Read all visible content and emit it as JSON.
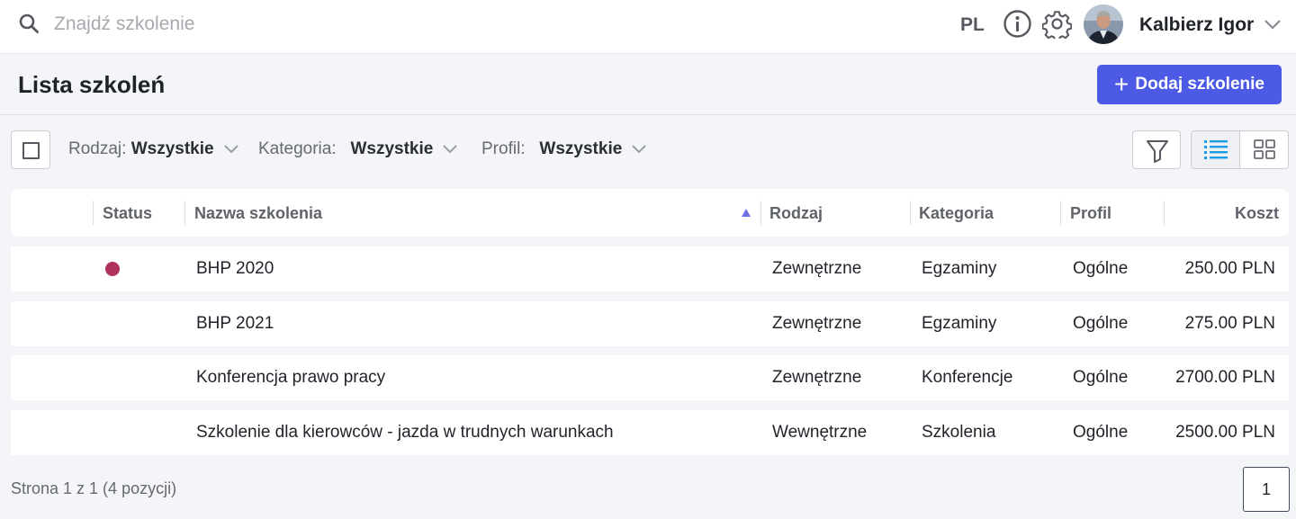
{
  "search": {
    "placeholder": "Znajdź szkolenie",
    "value": ""
  },
  "topbar": {
    "language": "PL",
    "user_name": "Kalbierz Igor"
  },
  "page": {
    "title": "Lista szkoleń",
    "add_button_label": "Dodaj szkolenie"
  },
  "filters": [
    {
      "label": "Rodzaj:",
      "value": "Wszystkie"
    },
    {
      "label": "Kategoria:",
      "value": "Wszystkie"
    },
    {
      "label": "Profil:",
      "value": "Wszystkie"
    }
  ],
  "table": {
    "columns": [
      "Status",
      "Nazwa szkolenia",
      "Rodzaj",
      "Kategoria",
      "Profil",
      "Koszt"
    ],
    "sorted_column": "Nazwa szkolenia",
    "sort_direction": "ascending",
    "rows": [
      {
        "status_color": "#b0335e",
        "name": "BHP 2020",
        "rodzaj": "Zewnętrzne",
        "kategoria": "Egzaminy",
        "profil": "Ogólne",
        "koszt": "250.00 PLN"
      },
      {
        "status_color": "",
        "name": "BHP 2021",
        "rodzaj": "Zewnętrzne",
        "kategoria": "Egzaminy",
        "profil": "Ogólne",
        "koszt": "275.00 PLN"
      },
      {
        "status_color": "",
        "name": "Konferencja prawo pracy",
        "rodzaj": "Zewnętrzne",
        "kategoria": "Konferencje",
        "profil": "Ogólne",
        "koszt": "2700.00 PLN"
      },
      {
        "status_color": "",
        "name": "Szkolenie dla kierowców - jazda w trudnych warunkach",
        "rodzaj": "Wewnętrzne",
        "kategoria": "Szkolenia",
        "profil": "Ogólne",
        "koszt": "2500.00 PLN"
      }
    ]
  },
  "pagination": {
    "info": "Strona 1 z 1 (4 pozycji)",
    "current_page": "1"
  },
  "icons": {
    "search": "search-icon",
    "info": "info-icon",
    "settings": "gear-icon",
    "user_menu": "chevron-down-icon",
    "filter": "funnel-icon",
    "list_view": "list-view-icon",
    "grid_view": "grid-view-icon",
    "sort": "sort-ascending-icon"
  },
  "colors": {
    "accent": "#4d5ae6",
    "list_icon": "#1a9be8",
    "status_dot": "#b0335e"
  }
}
